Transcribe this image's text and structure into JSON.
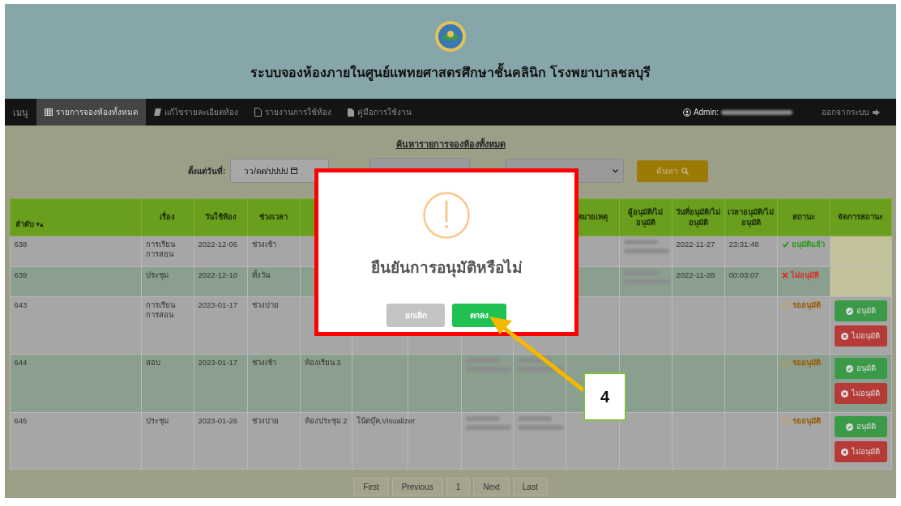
{
  "header": {
    "title": "ระบบจองห้องภายในศูนย์แพทยศาสตรศึกษาชั้นคลินิก โรงพยาบาลชลบุรี"
  },
  "navbar": {
    "brand": "เมนู",
    "items": [
      {
        "label": "รายการจองห้องทั้งหมด",
        "selected": true
      },
      {
        "label": "แก้ไขรายละเอียดห้อง",
        "selected": false
      },
      {
        "label": "รายงานการใช้ห้อง",
        "selected": false
      },
      {
        "label": "คู่มือการใช้งาน",
        "selected": false
      }
    ],
    "user_label": "Admin:",
    "logout": "ออกจากระบบ"
  },
  "search": {
    "title": "ค้นหารายการจองห้องทั้งหมด",
    "from_label": "ตั้งแต่วันที่:",
    "from_placeholder": "วว/ดด/ปปปป",
    "button": "ค้นหา"
  },
  "table": {
    "columns": [
      {
        "label": "ลำดับ",
        "sort": "▾▴"
      },
      {
        "label": "เรื่อง"
      },
      {
        "label": "วันใช้ห้อง"
      },
      {
        "label": "ช่วงเวลา"
      },
      {},
      {},
      {},
      {},
      {},
      {
        "label": "หมายเหตุ"
      },
      {
        "label": "ผู้อนุมัติ/ไม่อนุมัติ"
      },
      {
        "label": "วันที่อนุมัติ/ไม่อนุมัติ"
      },
      {
        "label": "เวลาอนุมัติ/ไม่อนุมัติ"
      },
      {
        "label": "สถานะ"
      },
      {
        "label": "จัดการสถานะ"
      }
    ],
    "rows": [
      {
        "cells": [
          "638",
          "การเรียน การสอน",
          "2022-12-06",
          "ช่วงเช้า",
          null,
          null,
          null,
          null,
          null,
          null,
          {
            "redacted": true
          },
          "2022-11-27",
          "23:31:48"
        ],
        "status": {
          "kind": "approved",
          "label": "อนุมัติแล้ว"
        }
      },
      {
        "cells": [
          "639",
          "ประชุม",
          "2022-12-10",
          "ทั้งวัน",
          null,
          null,
          null,
          null,
          null,
          null,
          {
            "redacted": true
          },
          "2022-11-28",
          "00:03:07"
        ],
        "status": {
          "kind": "rejected",
          "label": "ไม่อนุมัติ"
        }
      },
      {
        "cells": [
          "643",
          "การเรียน การสอน",
          "2023-01-17",
          "ช่วงบ่าย",
          null,
          null,
          null,
          null,
          null,
          null,
          null,
          null,
          null
        ],
        "status": {
          "kind": "pending",
          "label": "รออนุมัติ"
        },
        "actions": [
          {
            "kind": "approve",
            "label": "อนุมัติ"
          },
          {
            "kind": "reject",
            "label": "ไม่อนุมัติ"
          }
        ]
      },
      {
        "cells": [
          "644",
          "สอบ",
          "2023-01-17",
          "ช่วงเช้า",
          "ห้องเรียน 3",
          null,
          null,
          {
            "redacted": true
          },
          {
            "redacted": true
          },
          null,
          null,
          null,
          null
        ],
        "status": {
          "kind": "pending",
          "label": "รออนุมัติ"
        },
        "actions": [
          {
            "kind": "approve",
            "label": "อนุมัติ"
          },
          {
            "kind": "reject",
            "label": "ไม่อนุมัติ"
          }
        ]
      },
      {
        "cells": [
          "645",
          "ประชุม",
          "2023-01-26",
          "ช่วงบ่าย",
          "ห้องประชุม 2",
          "โน้ตบุ๊ค,Visualizer",
          null,
          {
            "redacted": true
          },
          {
            "redacted": true
          },
          null,
          null,
          null,
          null
        ],
        "status": {
          "kind": "pending",
          "label": "รออนุมัติ"
        },
        "actions": [
          {
            "kind": "approve",
            "label": "อนุมัติ"
          },
          {
            "kind": "reject",
            "label": "ไม่อนุมัติ"
          }
        ]
      }
    ]
  },
  "pagination": [
    "First",
    "Previous",
    "1",
    "Next",
    "Last"
  ],
  "dialog": {
    "title": "ยืนยันการอนุมัติหรือไม่",
    "cancel": "ยกเลิก",
    "confirm": "ตกลง"
  },
  "annotation": {
    "step": "4"
  }
}
